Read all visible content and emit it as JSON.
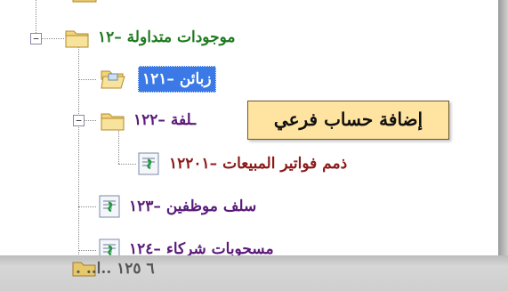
{
  "tree": {
    "nodes": [
      {
        "label": "موجودات متداولة  –١٢",
        "toggle": "−",
        "icon": "folder-icon"
      },
      {
        "label": "زبائن  –١٢١",
        "icon": "folder-open-icon",
        "selected": true
      },
      {
        "label": "ـلفة  –١٢٢",
        "toggle": "−",
        "icon": "folder-icon"
      },
      {
        "label": "ذمم فواتير المبيعات  –١٢٢٠١",
        "icon": "account-doc-icon"
      },
      {
        "label": "سلف موظفين  –١٢٣",
        "icon": "account-doc-icon"
      },
      {
        "label": "مسحوبات شركاء  –١٢٤",
        "icon": "account-doc-icon"
      }
    ],
    "partial_bottom_label": "٦ ١٢٥  ..ا.. ."
  },
  "tooltip": {
    "text": "إضافة حساب فرعي"
  },
  "colors": {
    "selected_bg": "#3a79e6",
    "tooltip_bg": "#ffe3a0",
    "green_label": "#1f7a1f",
    "purple_label": "#5a1a7a",
    "red_label": "#8b1a1a"
  }
}
